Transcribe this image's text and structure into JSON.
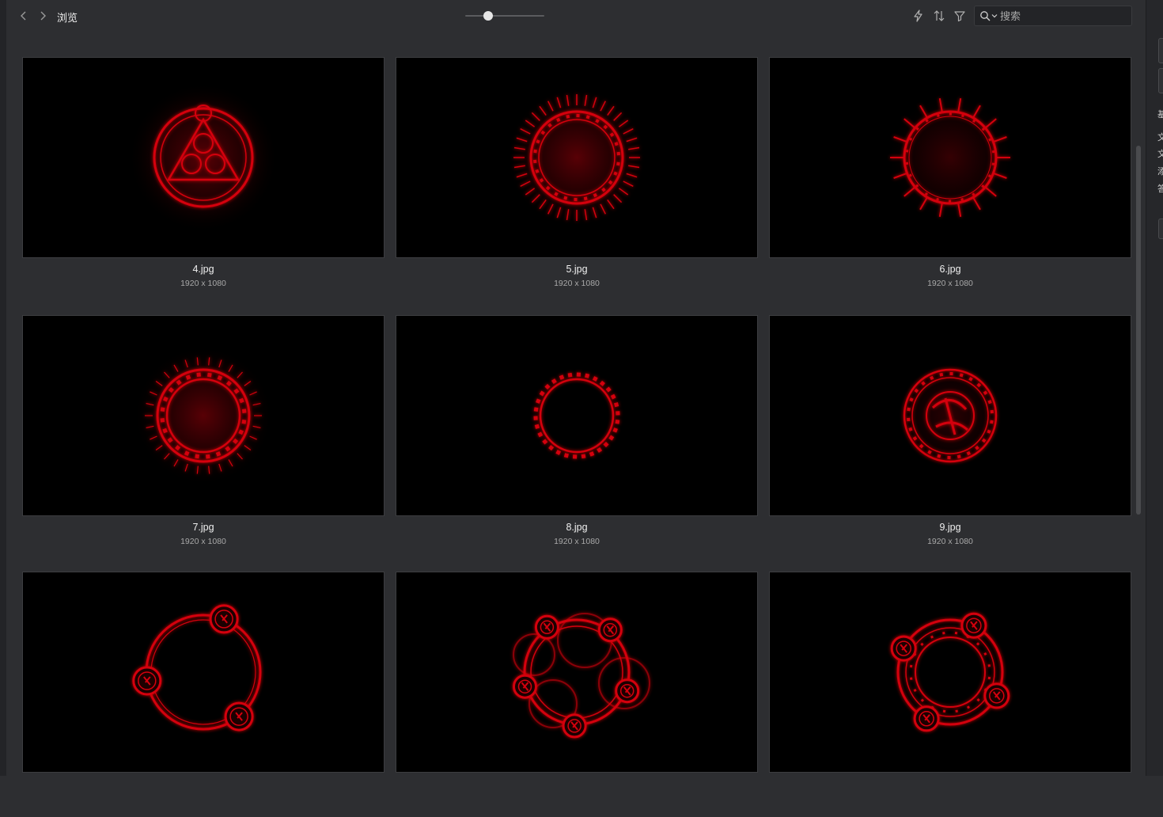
{
  "toolbar": {
    "title": "浏览",
    "back_icon": "chevron-left-icon",
    "forward_icon": "chevron-right-icon",
    "zoom_level": 0.26,
    "tools": [
      "flash-icon",
      "sort-icon",
      "filter-icon"
    ],
    "search": {
      "placeholder": "搜索",
      "icon": "search-icon"
    }
  },
  "colors": {
    "background": "#2d2e31",
    "thumb_background": "#000000",
    "accent_red": "#d4000f",
    "text_primary": "#f0f0f0",
    "text_secondary": "#a8a8a8"
  },
  "images": [
    {
      "name": "4.jpg",
      "dimensions": "1920 x 1080",
      "motif": "triangle-circle-sigil"
    },
    {
      "name": "5.jpg",
      "dimensions": "1920 x 1080",
      "motif": "rune-ring-flare"
    },
    {
      "name": "6.jpg",
      "dimensions": "1920 x 1080",
      "motif": "spiked-ring"
    },
    {
      "name": "7.jpg",
      "dimensions": "1920 x 1080",
      "motif": "thick-glow-ring"
    },
    {
      "name": "8.jpg",
      "dimensions": "1920 x 1080",
      "motif": "rune-ring"
    },
    {
      "name": "9.jpg",
      "dimensions": "1920 x 1080",
      "motif": "filled-sigil"
    },
    {
      "name": "",
      "dimensions": "",
      "motif": "three-node-ring"
    },
    {
      "name": "",
      "dimensions": "",
      "motif": "five-node-ring"
    },
    {
      "name": "",
      "dimensions": "",
      "motif": "double-node-ring"
    }
  ],
  "right_panel": {
    "labels": [
      "基",
      "文",
      "文",
      "添",
      "答"
    ]
  }
}
